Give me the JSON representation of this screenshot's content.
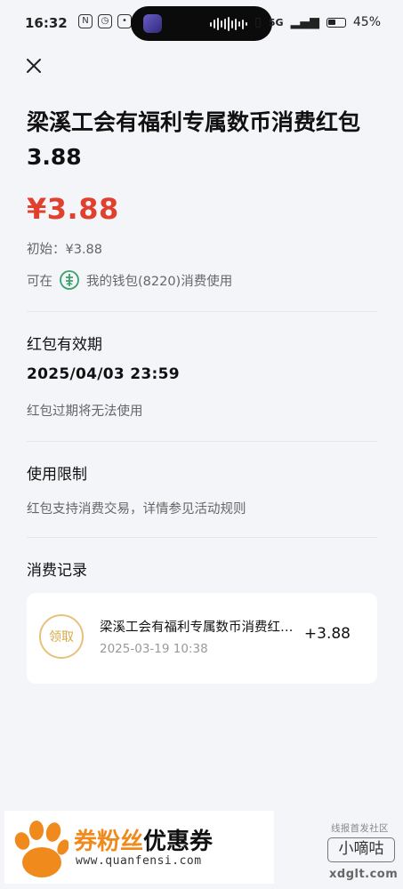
{
  "status_bar": {
    "time": "16:32",
    "network": "5G",
    "battery": "45%"
  },
  "header": {
    "title": "梁溪工会有福利专属数币消费红包3.88"
  },
  "summary": {
    "amount": "¥3.88",
    "initial": "初始：¥3.88",
    "usable_prefix": "可在",
    "wallet": "我的钱包(8220)消费使用"
  },
  "expiry": {
    "title": "红包有效期",
    "date": "2025/04/03 23:59",
    "note": "红包过期将无法使用"
  },
  "limits": {
    "title": "使用限制",
    "desc": "红包支持消费交易，详情参见活动规则"
  },
  "records": {
    "title": "消费记录",
    "items": [
      {
        "badge": "领取",
        "name": "梁溪工会有福利专属数币消费红包3.88",
        "time": "2025-03-19 10:38",
        "amount": "+3.88"
      }
    ]
  },
  "watermark": {
    "brand_part1": "券粉丝",
    "brand_part2": "优惠券",
    "url": "www.quanfensi.com",
    "community_tag": "线报首发社区",
    "community_name": "小嘀咕",
    "community_domain": "xdglt.com"
  },
  "colors": {
    "amount_red": "#e0412f",
    "badge_gold": "#d7a949",
    "bank_green": "#3aa06a"
  }
}
